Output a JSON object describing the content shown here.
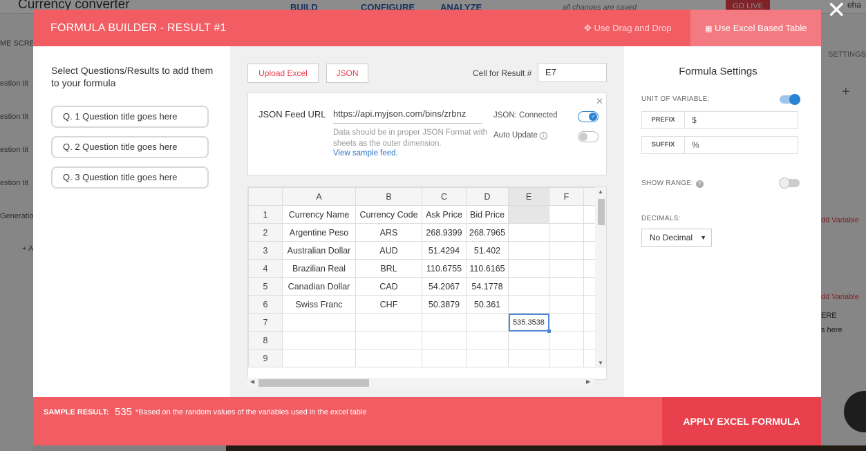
{
  "background": {
    "app_title": "Currency converter",
    "nav": [
      "BUILD",
      "CONFIGURE",
      "ANALYZE"
    ],
    "saved_status": "all changes are saved",
    "go_live": "GO LIVE",
    "user_name": "eha",
    "left_items": [
      "ME SCRE",
      "estion tit",
      "estion tit",
      "estion tit",
      "estion tit",
      "Generation",
      "+ A"
    ],
    "right_items": [
      "SETTINGS",
      "+",
      "dd Variable",
      "dd Variable",
      "ERE",
      "s here"
    ]
  },
  "modal": {
    "title": "FORMULA BUILDER - RESULT #1",
    "tabs": {
      "drag": "Use Drag and Drop",
      "excel": "Use Excel Based Table"
    },
    "left": {
      "heading": "Select Questions/Results to add them to your formula",
      "questions": [
        "Q. 1 Question title goes here",
        "Q. 2 Question title goes here",
        "Q. 3 Question title goes here"
      ]
    },
    "middle": {
      "upload_excel": "Upload Excel",
      "json_btn": "JSON",
      "cell_label": "Cell for Result #",
      "cell_value": "E7",
      "json_feed": {
        "label": "JSON Feed URL",
        "url": "https://api.myjson.com/bins/zrbnz",
        "help": "Data should be in proper JSON Format with sheets as the outer dimension.",
        "sample_link": "View sample feed.",
        "status": "JSON: Connected",
        "auto_update": "Auto Update",
        "status_on": true,
        "auto_update_on": false
      },
      "sheet": {
        "columns": [
          "A",
          "B",
          "C",
          "D",
          "E",
          "F"
        ],
        "rows": [
          [
            "1",
            "Currency Name",
            "Currency Code",
            "Ask Price",
            "Bid Price",
            "",
            ""
          ],
          [
            "2",
            "Argentine Peso",
            "ARS",
            "268.9399",
            "268.7965",
            "",
            ""
          ],
          [
            "3",
            "Australian Dollar",
            "AUD",
            "51.4294",
            "51.402",
            "",
            ""
          ],
          [
            "4",
            "Brazilian Real",
            "BRL",
            "110.6755",
            "110.6165",
            "",
            ""
          ],
          [
            "5",
            "Canadian Dollar",
            "CAD",
            "54.2067",
            "54.1778",
            "",
            ""
          ],
          [
            "6",
            "Swiss Franc",
            "CHF",
            "50.3879",
            "50.361",
            "",
            ""
          ],
          [
            "7",
            "",
            "",
            "",
            "",
            "535.3538",
            ""
          ],
          [
            "8",
            "",
            "",
            "",
            "",
            "",
            ""
          ],
          [
            "9",
            "",
            "",
            "",
            "",
            "",
            ""
          ]
        ]
      }
    },
    "right": {
      "title": "Formula Settings",
      "unit_label": "UNIT OF VARIABLE:",
      "unit_on": true,
      "prefix_label": "PREFIX",
      "prefix_value": "$",
      "suffix_label": "SUFFIX",
      "suffix_value": "%",
      "range_label": "SHOW RANGE:",
      "range_on": false,
      "decimals_label": "DECIMALS:",
      "decimals_value": "No Decimal"
    },
    "footer": {
      "sample_label": "SAMPLE RESULT:",
      "sample_value": "535",
      "sample_note": "*Based on the random values of the variables used in the excel table",
      "apply": "APPLY EXCEL FORMULA"
    }
  },
  "colors": {
    "accent": "#f25c63",
    "accent_dark": "#e8404c",
    "toggle_on": "#2a84d1",
    "link": "#2a77c9"
  }
}
